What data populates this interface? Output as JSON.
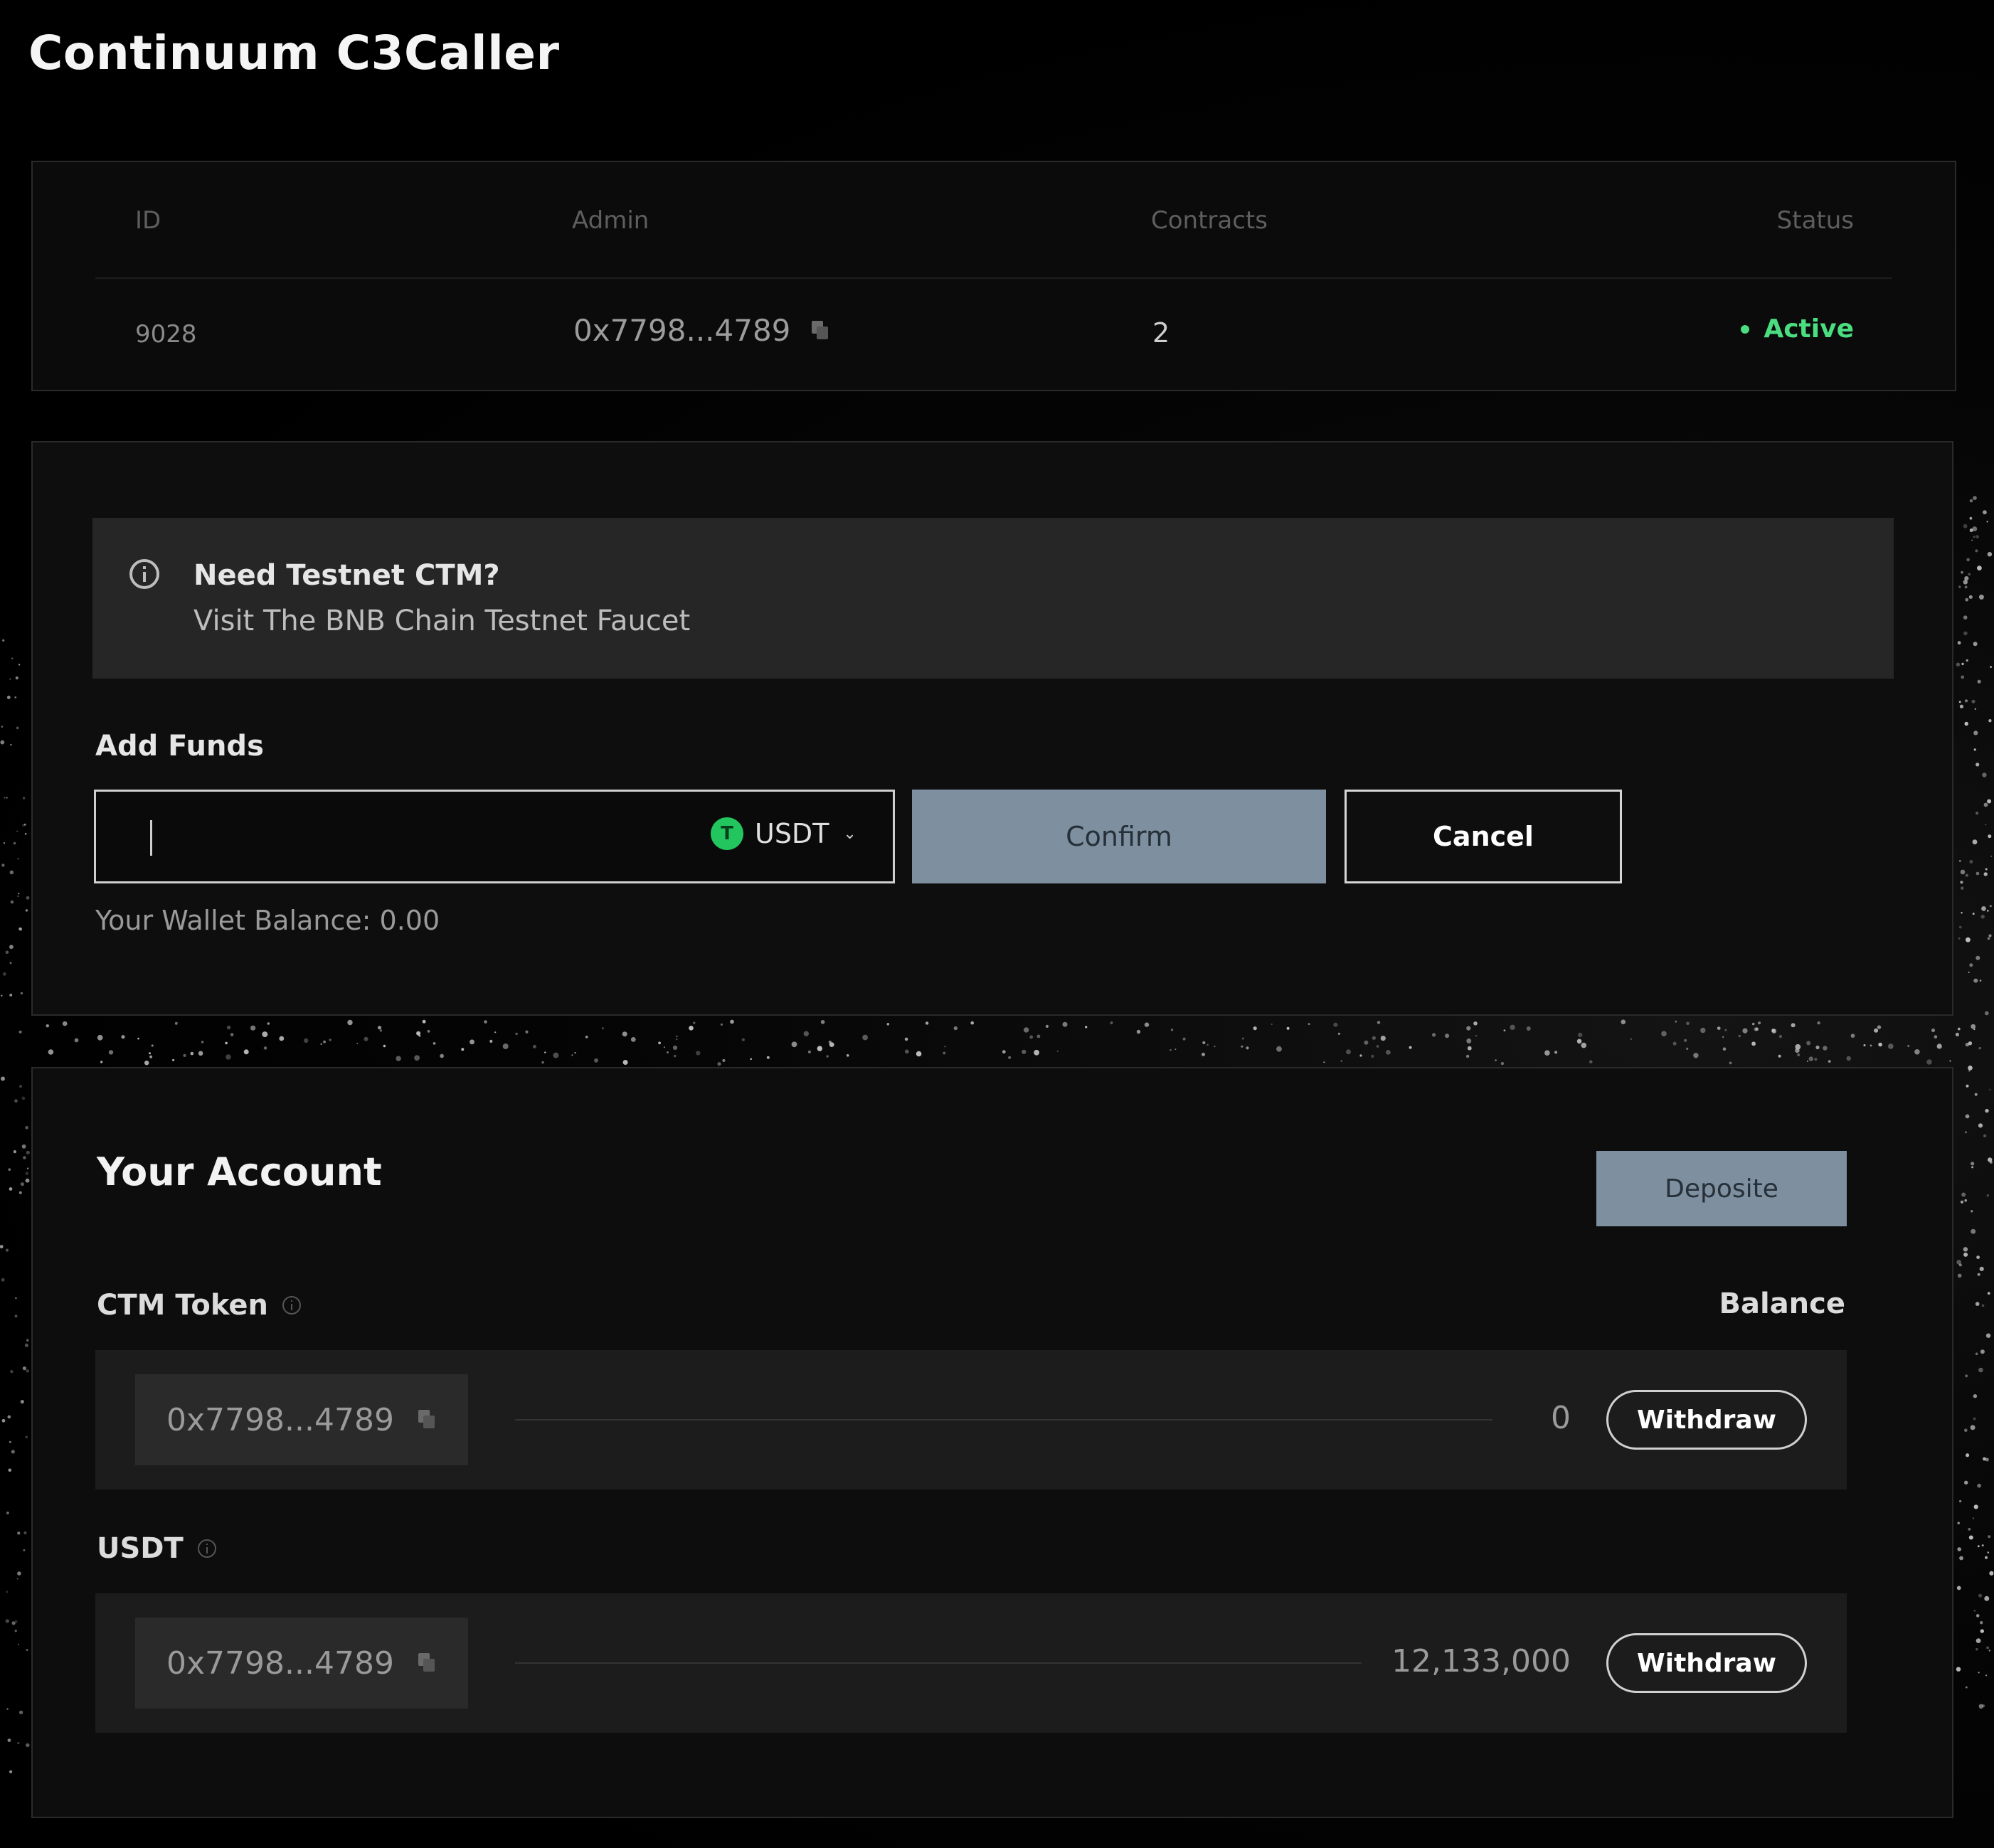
{
  "app": {
    "title": "Continuum C3Caller"
  },
  "summary_table": {
    "headers": {
      "id": "ID",
      "admin": "Admin",
      "contracts": "Contracts",
      "status": "Status"
    },
    "row": {
      "id": "9028",
      "admin": "0x7798...4789",
      "contracts": "2",
      "status": "Active"
    },
    "status_color": "#4ade80"
  },
  "faucet_notice": {
    "title": "Need Testnet CTM?",
    "link": "Visit The BNB Chain Testnet Faucet"
  },
  "add_funds": {
    "label": "Add Funds",
    "amount_value": "",
    "token": "USDT",
    "token_icon_glyph": "T",
    "confirm_label": "Confirm",
    "cancel_label": "Cancel",
    "wallet_balance": "Your Wallet Balance: 0.00",
    "token_icon_color": "#22c55e",
    "button_color": "#7e8fa0"
  },
  "account": {
    "title": "Your Account",
    "deposit_label": "Deposite",
    "balance_header": "Balance",
    "tokens": [
      {
        "name": "CTM Token",
        "address": "0x7798...4789",
        "balance": "0",
        "withdraw_label": "Withdraw"
      },
      {
        "name": "USDT",
        "address": "0x7798...4789",
        "balance": "12,133,000",
        "withdraw_label": "Withdraw"
      }
    ]
  }
}
